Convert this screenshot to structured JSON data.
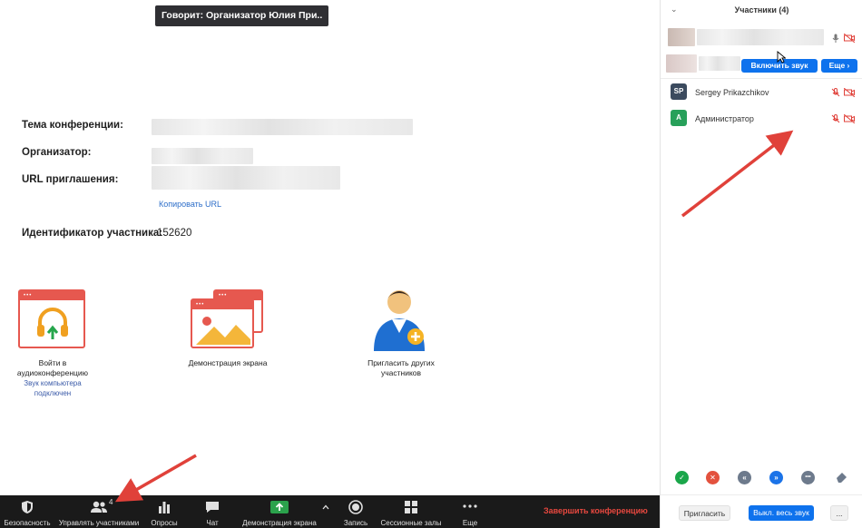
{
  "speaker": {
    "text": "Говорит: Организатор Юлия При.."
  },
  "info": {
    "topic_label": "Тема конференции:",
    "host_label": "Организатор:",
    "url_label": "URL приглашения:",
    "copy_url": "Копировать URL",
    "participant_id_label": "Идентификатор участника:",
    "participant_id_value": "152620"
  },
  "actions": {
    "join_audio_line1": "Войти в",
    "join_audio_line2": "аудиоконференцию",
    "join_audio_sub_line1": "Звук компьютера",
    "join_audio_sub_line2": "подключен",
    "share_screen": "Демонстрация экрана",
    "invite_line1": "Пригласить других",
    "invite_line2": "участников"
  },
  "panel": {
    "title": "Участники (4)",
    "collapse_icon": "chevron-down-icon",
    "unmute_button": "Включить звук",
    "more_button": "Еще ›",
    "participants": [
      {
        "initials": "SP",
        "name": "Sergey Prikazchikov",
        "color": "#3b4a5e"
      },
      {
        "initials": "A",
        "name": "Администратор",
        "color": "#27a05a"
      }
    ],
    "reactions": [
      {
        "icon": "check-icon",
        "symbol": "✓",
        "color": "#1aa64a"
      },
      {
        "icon": "cross-icon",
        "symbol": "✕",
        "color": "#e3523e"
      },
      {
        "icon": "rewind-icon",
        "symbol": "«",
        "color": "#6d7a8c"
      },
      {
        "icon": "fast-forward-icon",
        "symbol": "»",
        "color": "#1b73e8"
      },
      {
        "icon": "more-dots-icon",
        "symbol": "•••",
        "color": "#6d7a8c"
      }
    ],
    "invite_button": "Пригласить",
    "mute_all_button": "Выкл. весь звук",
    "more_dots": "..."
  },
  "toolbar": {
    "security": "Безопасность",
    "participants": "Управлять участниками",
    "participants_count": "4",
    "polls": "Опросы",
    "chat": "Чат",
    "share": "Демонстрация экрана",
    "record": "Запись",
    "breakout": "Сессионные залы",
    "more": "Еще",
    "end": "Завершить конференцию"
  },
  "colors": {
    "accent_blue": "#0e72ed",
    "end_red": "#e8483f",
    "tile_red": "#e6584f",
    "share_green": "#2ba24c",
    "arrow_red": "#e0413a"
  }
}
